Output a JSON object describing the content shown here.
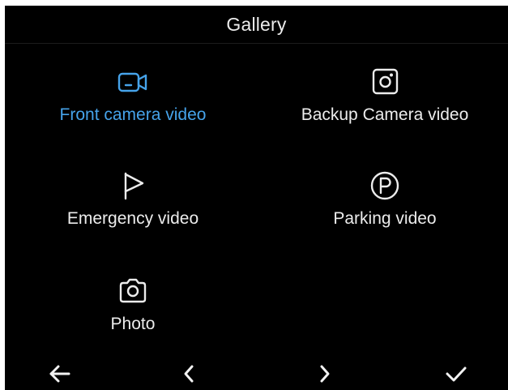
{
  "header": {
    "title": "Gallery"
  },
  "menu": {
    "items": [
      {
        "id": "front-camera-video",
        "label": "Front camera video",
        "icon": "video-camera-icon",
        "selected": true
      },
      {
        "id": "backup-camera-video",
        "label": "Backup Camera video",
        "icon": "rear-camera-icon",
        "selected": false
      },
      {
        "id": "emergency-video",
        "label": "Emergency video",
        "icon": "flag-icon",
        "selected": false
      },
      {
        "id": "parking-video",
        "label": "Parking video",
        "icon": "parking-icon",
        "selected": false
      },
      {
        "id": "photo",
        "label": "Photo",
        "icon": "camera-icon",
        "selected": false
      }
    ]
  },
  "footer": {
    "buttons": [
      {
        "id": "back",
        "icon": "arrow-left-icon"
      },
      {
        "id": "previous",
        "icon": "chevron-left-icon"
      },
      {
        "id": "next",
        "icon": "chevron-right-icon"
      },
      {
        "id": "confirm",
        "icon": "check-icon"
      }
    ]
  },
  "colors": {
    "background": "#000000",
    "text": "#ececec",
    "accent": "#46a3ea"
  }
}
